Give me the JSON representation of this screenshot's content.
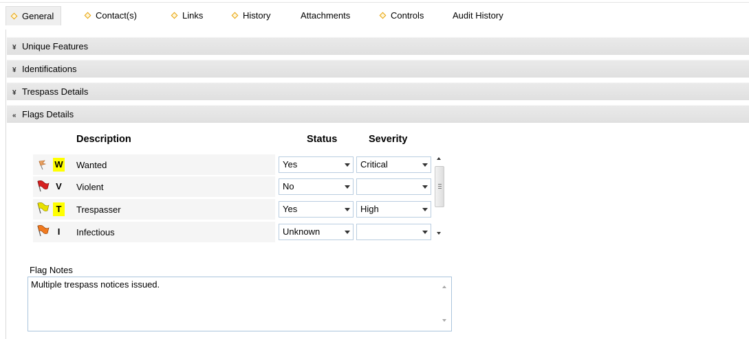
{
  "tabs": [
    {
      "label": "General",
      "icon": "diamond-icon",
      "active": true
    },
    {
      "label": "Contact(s)",
      "icon": "diamond-icon"
    },
    {
      "label": "Links",
      "icon": "diamond-icon"
    },
    {
      "label": "History",
      "icon": "diamond-icon"
    },
    {
      "label": "Attachments"
    },
    {
      "label": "Controls",
      "icon": "diamond-icon"
    },
    {
      "label": "Audit History"
    }
  ],
  "sections": [
    {
      "label": "Unique Features",
      "chevron": "¥",
      "state": "collapsed"
    },
    {
      "label": "Identifications",
      "chevron": "¥",
      "state": "collapsed"
    },
    {
      "label": "Trespass Details",
      "chevron": "¥",
      "state": "collapsed"
    },
    {
      "label": "Flags Details",
      "chevron": "«",
      "state": "expanded"
    }
  ],
  "flags": {
    "headers": {
      "description": "Description",
      "status": "Status",
      "severity": "Severity"
    },
    "rows": [
      {
        "flag_color": "#e8a060",
        "flag_style": "small",
        "code": "W",
        "highlight": true,
        "description": "Wanted",
        "status": "Yes",
        "severity": "Critical"
      },
      {
        "flag_color": "#d62020",
        "flag_style": "full",
        "code": "V",
        "highlight": false,
        "description": "Violent",
        "status": "No",
        "severity": ""
      },
      {
        "flag_color": "#e8e000",
        "flag_style": "full",
        "code": "T",
        "highlight": true,
        "description": "Trespasser",
        "status": "Yes",
        "severity": "High"
      },
      {
        "flag_color": "#f07a20",
        "flag_style": "full",
        "code": "I",
        "highlight": false,
        "description": "Infectious",
        "status": "Unknown",
        "severity": ""
      }
    ]
  },
  "notes": {
    "label": "Flag Notes",
    "value": "Multiple trespass notices issued."
  },
  "colors": {
    "tab_diamond": "#e8a30c",
    "highlight": "#ffff00",
    "section_bg": "#e4e4e4"
  }
}
